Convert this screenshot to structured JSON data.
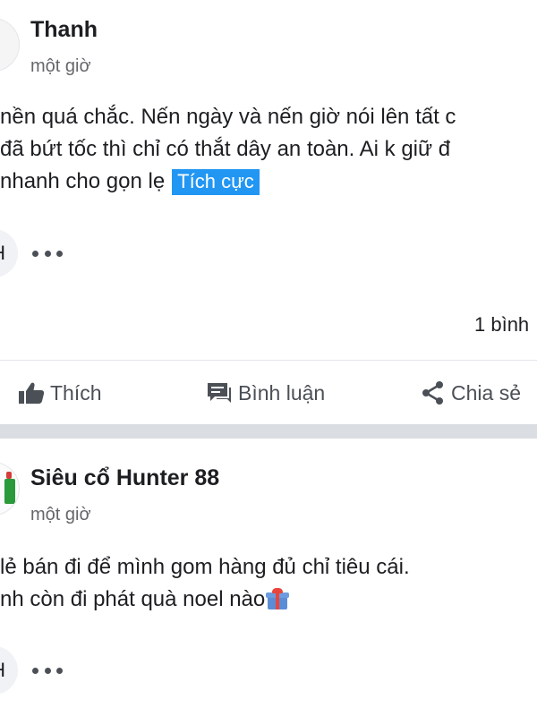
{
  "posts": [
    {
      "author": "Thanh",
      "time": "một giờ",
      "lines": [
        "nền quá chắc. Nến ngày và nến giờ nói lên tất c",
        "đã bứt tốc thì chỉ có thắt dây an toàn. Ai k giữ đ",
        "nhanh cho gọn lẹ"
      ],
      "tag": "Tích cực",
      "reaction_letter": "H",
      "comment_count": "1 bình",
      "actions": {
        "like": "Thích",
        "comment": "Bình luận",
        "share": "Chia sẻ"
      }
    },
    {
      "author": "Siêu cổ Hunter 88",
      "time": "một giờ",
      "lines": [
        " lẻ bán đi để mình gom hàng đủ chỉ tiêu cái.",
        "nh còn đi phát quà noel nào"
      ],
      "emoji": "gift-icon",
      "reaction_letter": "H"
    }
  ],
  "colors": {
    "tag_background": "#2196f3",
    "secondary_text": "#65676b",
    "section_gap": "#dadde1"
  }
}
